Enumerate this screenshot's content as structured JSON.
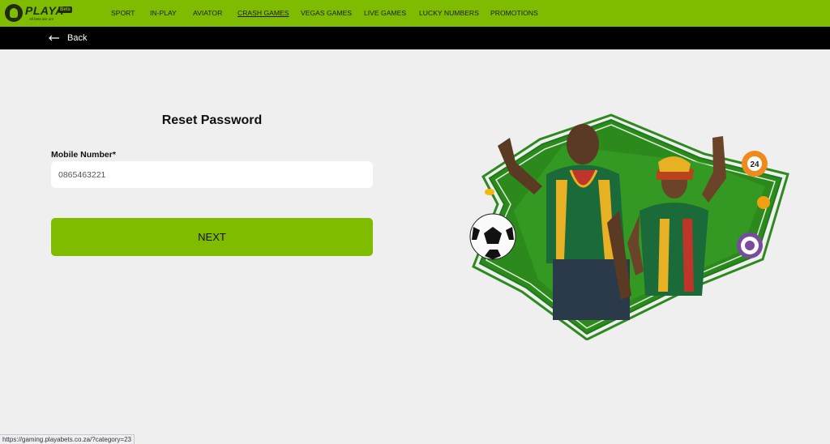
{
  "brand": {
    "name": "PLAYA",
    "tag": "Bets",
    "tagline": "All bets are on!"
  },
  "nav": {
    "items": [
      {
        "label": "SPORT"
      },
      {
        "label": "IN-PLAY"
      },
      {
        "label": "AVIATOR"
      },
      {
        "label": "CRASH GAMES",
        "active": true
      },
      {
        "label": "VEGAS GAMES"
      },
      {
        "label": "LIVE GAMES"
      },
      {
        "label": "LUCKY NUMBERS"
      },
      {
        "label": "PROMOTIONS"
      }
    ]
  },
  "subnav": {
    "back_label": "Back"
  },
  "form": {
    "title": "Reset Password",
    "mobile_label": "Mobile Number*",
    "mobile_value": "0865463221",
    "next_label": "NEXT"
  },
  "promo": {
    "ball_number": "24"
  },
  "status": {
    "url": "https://gaming.playabets.co.za/?category=23"
  },
  "colors": {
    "brand_green": "#7fbc00",
    "dark_green": "#1f2a10",
    "page_bg": "#efefef",
    "subbar_bg": "#000000"
  }
}
